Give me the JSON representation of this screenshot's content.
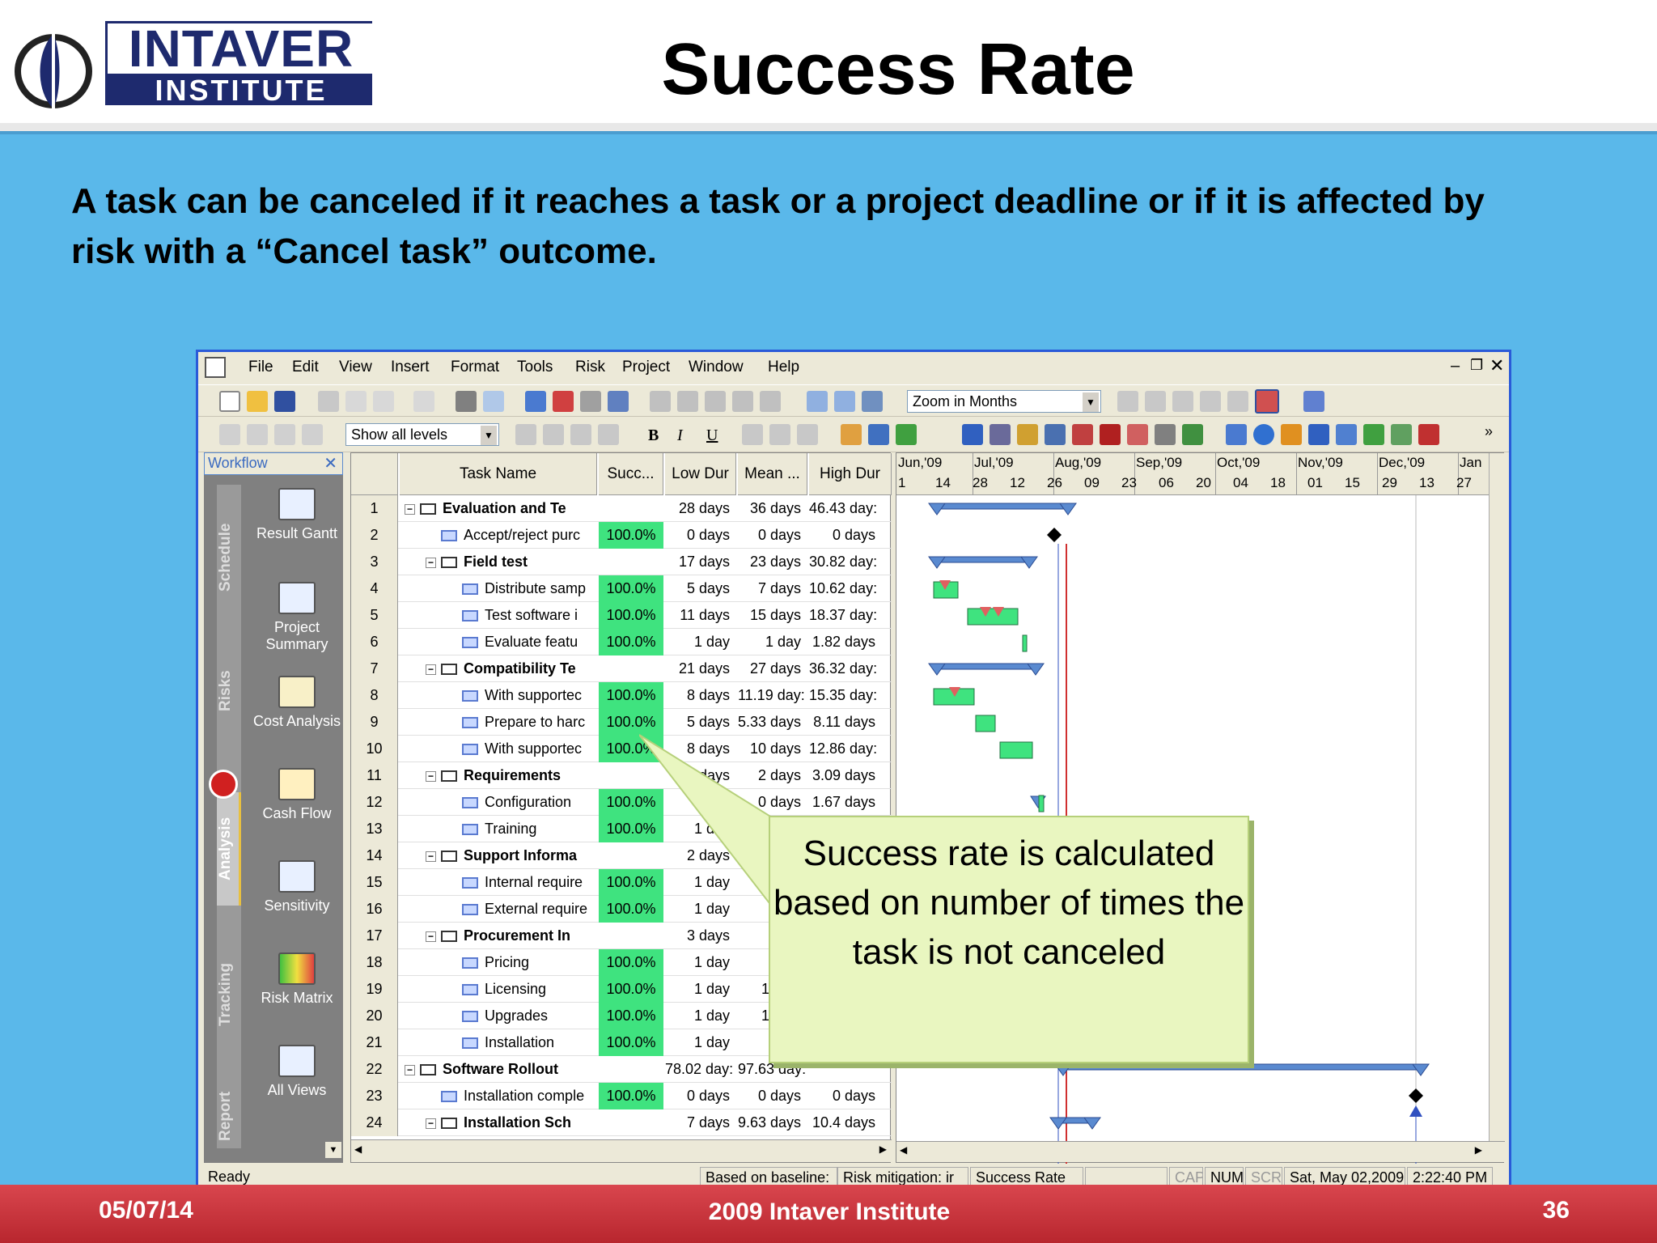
{
  "header": {
    "logo_top": "INTAVER",
    "logo_bottom": "INSTITUTE",
    "title": "Success Rate"
  },
  "body_text": "A task can be canceled if it reaches a task or a project deadline or if it is affected by risk with a  “Cancel task” outcome.",
  "app": {
    "menu": [
      "File",
      "Edit",
      "View",
      "Insert",
      "Format",
      "Tools",
      "Risk",
      "Project",
      "Window",
      "Help"
    ],
    "zoom_combo": "Zoom in Months",
    "levels_combo": "Show all levels",
    "workflow_title": "Workflow",
    "workflow_tabs": [
      "Schedule",
      "Risks",
      "Analysis",
      "Tracking",
      "Report"
    ],
    "workflow_items": [
      "Result Gantt",
      "Project Summary",
      "Cost Analysis",
      "Cash Flow",
      "Sensitivity",
      "Risk Matrix",
      "All Views"
    ],
    "columns": [
      "Task Name",
      "Succ...",
      "Low Dur",
      "Mean ...",
      "High Dur"
    ],
    "rows": [
      {
        "id": "1",
        "name": "Evaluation and Te",
        "succ": "",
        "low": "28 days",
        "mean": "36 days",
        "high": "46.43 day:",
        "level": 0,
        "summary": true
      },
      {
        "id": "2",
        "name": "Accept/reject purc",
        "succ": "100.0%",
        "low": "0 days",
        "mean": "0 days",
        "high": "0 days",
        "level": 1,
        "summary": false
      },
      {
        "id": "3",
        "name": "Field test",
        "succ": "",
        "low": "17 days",
        "mean": "23 days",
        "high": "30.82 day:",
        "level": 1,
        "summary": true
      },
      {
        "id": "4",
        "name": "Distribute samp",
        "succ": "100.0%",
        "low": "5 days",
        "mean": "7 days",
        "high": "10.62 day:",
        "level": 2,
        "summary": false
      },
      {
        "id": "5",
        "name": "Test software i",
        "succ": "100.0%",
        "low": "11 days",
        "mean": "15 days",
        "high": "18.37 day:",
        "level": 2,
        "summary": false
      },
      {
        "id": "6",
        "name": "Evaluate featu",
        "succ": "100.0%",
        "low": "1 day",
        "mean": "1 day",
        "high": "1.82 days",
        "level": 2,
        "summary": false
      },
      {
        "id": "7",
        "name": "Compatibility Te",
        "succ": "",
        "low": "21 days",
        "mean": "27 days",
        "high": "36.32 day:",
        "level": 1,
        "summary": true
      },
      {
        "id": "8",
        "name": "With supportec",
        "succ": "100.0%",
        "low": "8 days",
        "mean": "11.19 day:",
        "high": "15.35 day:",
        "level": 2,
        "summary": false
      },
      {
        "id": "9",
        "name": "Prepare to harc",
        "succ": "100.0%",
        "low": "5 days",
        "mean": "5.33 days",
        "high": "8.11 days",
        "level": 2,
        "summary": false
      },
      {
        "id": "10",
        "name": "With supportec",
        "succ": "100.0%",
        "low": "8 days",
        "mean": "10 days",
        "high": "12.86 day:",
        "level": 2,
        "summary": false
      },
      {
        "id": "11",
        "name": "Requirements",
        "succ": "",
        "low": "2 days",
        "mean": "2 days",
        "high": "3.09 days",
        "level": 1,
        "summary": true
      },
      {
        "id": "12",
        "name": "Configuration",
        "succ": "100.0%",
        "low": "1 d",
        "mean": "0 days",
        "high": "1.67 days",
        "level": 2,
        "summary": false
      },
      {
        "id": "13",
        "name": "Training",
        "succ": "100.0%",
        "low": "1 day",
        "mean": "1 d",
        "high": "",
        "level": 2,
        "summary": false
      },
      {
        "id": "14",
        "name": "Support Informa",
        "succ": "",
        "low": "2 days",
        "mean": "",
        "high": "",
        "level": 1,
        "summary": true
      },
      {
        "id": "15",
        "name": "Internal require",
        "succ": "100.0%",
        "low": "1 day",
        "mean": "1",
        "high": "",
        "level": 2,
        "summary": false
      },
      {
        "id": "16",
        "name": "External require",
        "succ": "100.0%",
        "low": "1 day",
        "mean": "1",
        "high": "",
        "level": 2,
        "summary": false
      },
      {
        "id": "17",
        "name": "Procurement In",
        "succ": "",
        "low": "3 days",
        "mean": "4 da",
        "high": "",
        "level": 1,
        "summary": true
      },
      {
        "id": "18",
        "name": "Pricing",
        "succ": "100.0%",
        "low": "1 day",
        "mean": "0 da",
        "high": "",
        "level": 2,
        "summary": false
      },
      {
        "id": "19",
        "name": "Licensing",
        "succ": "100.0%",
        "low": "1 day",
        "mean": "1.98 c",
        "high": "",
        "level": 2,
        "summary": false
      },
      {
        "id": "20",
        "name": "Upgrades",
        "succ": "100.0%",
        "low": "1 day",
        "mean": "1.33 c",
        "high": "",
        "level": 2,
        "summary": false
      },
      {
        "id": "21",
        "name": "Installation",
        "succ": "100.0%",
        "low": "1 day",
        "mean": "0 da",
        "high": "",
        "level": 2,
        "summary": false
      },
      {
        "id": "22",
        "name": "Software Rollout",
        "succ": "",
        "low": "78.02 day:",
        "mean": "97.63 day:",
        "high": "",
        "level": 0,
        "summary": true
      },
      {
        "id": "23",
        "name": "Installation comple",
        "succ": "100.0%",
        "low": "0 days",
        "mean": "0 days",
        "high": "0 days",
        "level": 1,
        "summary": false
      },
      {
        "id": "24",
        "name": "Installation Sch",
        "succ": "",
        "low": "7 days",
        "mean": "9.63 days",
        "high": "10.4 days",
        "level": 1,
        "summary": true
      }
    ],
    "gantt_months": [
      "Jun,'09",
      "Jul,'09",
      "Aug,'09",
      "Sep,'09",
      "Oct,'09",
      "Nov,'09",
      "Dec,'09",
      "Jan"
    ],
    "gantt_days": [
      "1",
      "14",
      "28",
      "12",
      "26",
      "09",
      "23",
      "06",
      "20",
      "04",
      "18",
      "01",
      "15",
      "29",
      "13",
      "27"
    ],
    "status": {
      "ready": "Ready",
      "baseline": "Based on baseline:",
      "risk": "Risk mitigation: ir",
      "view": "Success Rate",
      "cap": "CAP",
      "num": "NUM",
      "scrl": "SCRL",
      "date": "Sat, May 02,2009",
      "time": "2:22:40 PM"
    }
  },
  "callout": "Success rate is calculated based on number of times the task is not canceled",
  "footer": {
    "date": "05/07/14",
    "center": "2009 Intaver Institute",
    "page": "36"
  },
  "colors": {
    "slide_bg": "#5ab8ea",
    "success_cell": "#3fe37f",
    "footer": "#c8323a",
    "callout_bg": "#e9f6c0",
    "logo_navy": "#1e2a6e"
  }
}
